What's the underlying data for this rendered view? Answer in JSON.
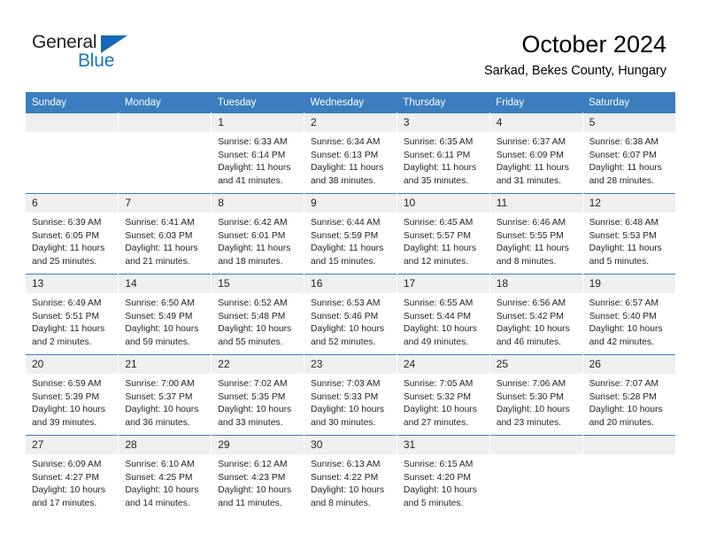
{
  "brand": {
    "line1": "General",
    "line2": "Blue",
    "triangle_color": "#1569b8",
    "line2_color": "#1c77c3"
  },
  "header": {
    "title": "October 2024",
    "subtitle": "Sarkad, Bekes County, Hungary"
  },
  "colors": {
    "header_blue": "#3b7dbf",
    "daynum_band": "#efefef",
    "text": "#231f20"
  },
  "weekday_headers": [
    "Sunday",
    "Monday",
    "Tuesday",
    "Wednesday",
    "Thursday",
    "Friday",
    "Saturday"
  ],
  "weeks": [
    [
      {
        "day": "",
        "sunrise": "",
        "sunset": "",
        "daylight_1": "",
        "daylight_2": ""
      },
      {
        "day": "",
        "sunrise": "",
        "sunset": "",
        "daylight_1": "",
        "daylight_2": ""
      },
      {
        "day": "1",
        "sunrise": "Sunrise: 6:33 AM",
        "sunset": "Sunset: 6:14 PM",
        "daylight_1": "Daylight: 11 hours",
        "daylight_2": "and 41 minutes."
      },
      {
        "day": "2",
        "sunrise": "Sunrise: 6:34 AM",
        "sunset": "Sunset: 6:13 PM",
        "daylight_1": "Daylight: 11 hours",
        "daylight_2": "and 38 minutes."
      },
      {
        "day": "3",
        "sunrise": "Sunrise: 6:35 AM",
        "sunset": "Sunset: 6:11 PM",
        "daylight_1": "Daylight: 11 hours",
        "daylight_2": "and 35 minutes."
      },
      {
        "day": "4",
        "sunrise": "Sunrise: 6:37 AM",
        "sunset": "Sunset: 6:09 PM",
        "daylight_1": "Daylight: 11 hours",
        "daylight_2": "and 31 minutes."
      },
      {
        "day": "5",
        "sunrise": "Sunrise: 6:38 AM",
        "sunset": "Sunset: 6:07 PM",
        "daylight_1": "Daylight: 11 hours",
        "daylight_2": "and 28 minutes."
      }
    ],
    [
      {
        "day": "6",
        "sunrise": "Sunrise: 6:39 AM",
        "sunset": "Sunset: 6:05 PM",
        "daylight_1": "Daylight: 11 hours",
        "daylight_2": "and 25 minutes."
      },
      {
        "day": "7",
        "sunrise": "Sunrise: 6:41 AM",
        "sunset": "Sunset: 6:03 PM",
        "daylight_1": "Daylight: 11 hours",
        "daylight_2": "and 21 minutes."
      },
      {
        "day": "8",
        "sunrise": "Sunrise: 6:42 AM",
        "sunset": "Sunset: 6:01 PM",
        "daylight_1": "Daylight: 11 hours",
        "daylight_2": "and 18 minutes."
      },
      {
        "day": "9",
        "sunrise": "Sunrise: 6:44 AM",
        "sunset": "Sunset: 5:59 PM",
        "daylight_1": "Daylight: 11 hours",
        "daylight_2": "and 15 minutes."
      },
      {
        "day": "10",
        "sunrise": "Sunrise: 6:45 AM",
        "sunset": "Sunset: 5:57 PM",
        "daylight_1": "Daylight: 11 hours",
        "daylight_2": "and 12 minutes."
      },
      {
        "day": "11",
        "sunrise": "Sunrise: 6:46 AM",
        "sunset": "Sunset: 5:55 PM",
        "daylight_1": "Daylight: 11 hours",
        "daylight_2": "and 8 minutes."
      },
      {
        "day": "12",
        "sunrise": "Sunrise: 6:48 AM",
        "sunset": "Sunset: 5:53 PM",
        "daylight_1": "Daylight: 11 hours",
        "daylight_2": "and 5 minutes."
      }
    ],
    [
      {
        "day": "13",
        "sunrise": "Sunrise: 6:49 AM",
        "sunset": "Sunset: 5:51 PM",
        "daylight_1": "Daylight: 11 hours",
        "daylight_2": "and 2 minutes."
      },
      {
        "day": "14",
        "sunrise": "Sunrise: 6:50 AM",
        "sunset": "Sunset: 5:49 PM",
        "daylight_1": "Daylight: 10 hours",
        "daylight_2": "and 59 minutes."
      },
      {
        "day": "15",
        "sunrise": "Sunrise: 6:52 AM",
        "sunset": "Sunset: 5:48 PM",
        "daylight_1": "Daylight: 10 hours",
        "daylight_2": "and 55 minutes."
      },
      {
        "day": "16",
        "sunrise": "Sunrise: 6:53 AM",
        "sunset": "Sunset: 5:46 PM",
        "daylight_1": "Daylight: 10 hours",
        "daylight_2": "and 52 minutes."
      },
      {
        "day": "17",
        "sunrise": "Sunrise: 6:55 AM",
        "sunset": "Sunset: 5:44 PM",
        "daylight_1": "Daylight: 10 hours",
        "daylight_2": "and 49 minutes."
      },
      {
        "day": "18",
        "sunrise": "Sunrise: 6:56 AM",
        "sunset": "Sunset: 5:42 PM",
        "daylight_1": "Daylight: 10 hours",
        "daylight_2": "and 46 minutes."
      },
      {
        "day": "19",
        "sunrise": "Sunrise: 6:57 AM",
        "sunset": "Sunset: 5:40 PM",
        "daylight_1": "Daylight: 10 hours",
        "daylight_2": "and 42 minutes."
      }
    ],
    [
      {
        "day": "20",
        "sunrise": "Sunrise: 6:59 AM",
        "sunset": "Sunset: 5:39 PM",
        "daylight_1": "Daylight: 10 hours",
        "daylight_2": "and 39 minutes."
      },
      {
        "day": "21",
        "sunrise": "Sunrise: 7:00 AM",
        "sunset": "Sunset: 5:37 PM",
        "daylight_1": "Daylight: 10 hours",
        "daylight_2": "and 36 minutes."
      },
      {
        "day": "22",
        "sunrise": "Sunrise: 7:02 AM",
        "sunset": "Sunset: 5:35 PM",
        "daylight_1": "Daylight: 10 hours",
        "daylight_2": "and 33 minutes."
      },
      {
        "day": "23",
        "sunrise": "Sunrise: 7:03 AM",
        "sunset": "Sunset: 5:33 PM",
        "daylight_1": "Daylight: 10 hours",
        "daylight_2": "and 30 minutes."
      },
      {
        "day": "24",
        "sunrise": "Sunrise: 7:05 AM",
        "sunset": "Sunset: 5:32 PM",
        "daylight_1": "Daylight: 10 hours",
        "daylight_2": "and 27 minutes."
      },
      {
        "day": "25",
        "sunrise": "Sunrise: 7:06 AM",
        "sunset": "Sunset: 5:30 PM",
        "daylight_1": "Daylight: 10 hours",
        "daylight_2": "and 23 minutes."
      },
      {
        "day": "26",
        "sunrise": "Sunrise: 7:07 AM",
        "sunset": "Sunset: 5:28 PM",
        "daylight_1": "Daylight: 10 hours",
        "daylight_2": "and 20 minutes."
      }
    ],
    [
      {
        "day": "27",
        "sunrise": "Sunrise: 6:09 AM",
        "sunset": "Sunset: 4:27 PM",
        "daylight_1": "Daylight: 10 hours",
        "daylight_2": "and 17 minutes."
      },
      {
        "day": "28",
        "sunrise": "Sunrise: 6:10 AM",
        "sunset": "Sunset: 4:25 PM",
        "daylight_1": "Daylight: 10 hours",
        "daylight_2": "and 14 minutes."
      },
      {
        "day": "29",
        "sunrise": "Sunrise: 6:12 AM",
        "sunset": "Sunset: 4:23 PM",
        "daylight_1": "Daylight: 10 hours",
        "daylight_2": "and 11 minutes."
      },
      {
        "day": "30",
        "sunrise": "Sunrise: 6:13 AM",
        "sunset": "Sunset: 4:22 PM",
        "daylight_1": "Daylight: 10 hours",
        "daylight_2": "and 8 minutes."
      },
      {
        "day": "31",
        "sunrise": "Sunrise: 6:15 AM",
        "sunset": "Sunset: 4:20 PM",
        "daylight_1": "Daylight: 10 hours",
        "daylight_2": "and 5 minutes."
      },
      {
        "day": "",
        "sunrise": "",
        "sunset": "",
        "daylight_1": "",
        "daylight_2": ""
      },
      {
        "day": "",
        "sunrise": "",
        "sunset": "",
        "daylight_1": "",
        "daylight_2": ""
      }
    ]
  ]
}
